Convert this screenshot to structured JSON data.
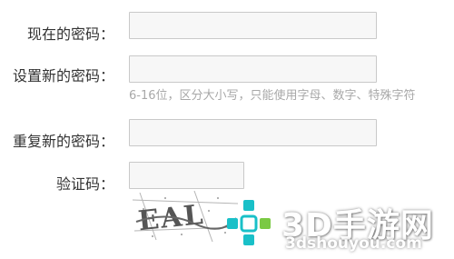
{
  "form": {
    "current_password_label": "现在的密码：",
    "new_password_label": "设置新的密码：",
    "password_hint": "6-16位，区分大小写，只能使用字母、数字、特殊字符",
    "repeat_password_label": "重复新的密码：",
    "captcha_label": "验证码："
  },
  "captcha": {
    "text": "EAL"
  },
  "watermark": {
    "title": "3D手游网",
    "url": "3dshouyou.com"
  },
  "colors": {
    "input_border": "#c9c9c9",
    "input_bg": "#f7f7f7",
    "hint": "#a8a8a8",
    "watermark_teal": "#19c0c8",
    "watermark_green": "#7ac943"
  }
}
